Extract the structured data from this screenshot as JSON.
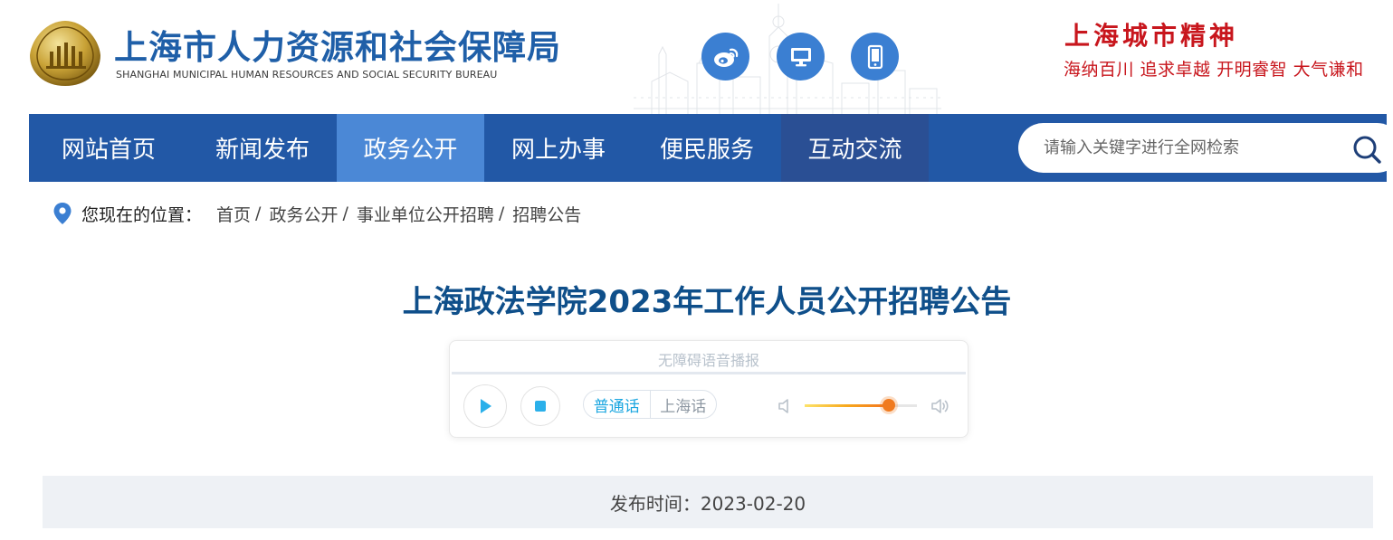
{
  "header": {
    "org_name_cn": "上海市人力资源和社会保障局",
    "org_name_en": "SHANGHAI MUNICIPAL HUMAN RESOURCES AND SOCIAL SECURITY BUREAU",
    "social_icons": [
      "weibo-icon",
      "monitor-icon",
      "mobile-icon"
    ],
    "spirit_title": "上海城市精神",
    "spirit_words": "海纳百川  追求卓越  开明睿智  大气谦和"
  },
  "nav": {
    "items": [
      {
        "label": "网站首页"
      },
      {
        "label": "新闻发布"
      },
      {
        "label": "政务公开"
      },
      {
        "label": "网上办事"
      },
      {
        "label": "便民服务"
      },
      {
        "label": "互动交流"
      }
    ],
    "active_index": 2
  },
  "search": {
    "placeholder": "请输入关键字进行全网检索",
    "value": ""
  },
  "breadcrumb": {
    "label": "您现在的位置：",
    "items": [
      "首页",
      "政务公开",
      "事业单位公开招聘",
      "招聘公告"
    ],
    "separator": "/"
  },
  "article": {
    "title": "上海政法学院2023年工作人员公开招聘公告",
    "publish_info": "发布时间：2023-02-20"
  },
  "audio_player": {
    "label": "无障碍语音播报",
    "progress": 0.0,
    "languages": [
      "普通话",
      "上海话"
    ],
    "selected_language": "普通话",
    "volume": 0.75
  },
  "colors": {
    "nav_bg": "#2258a6",
    "nav_active": "#4b88d6",
    "title": "#0f4f8a",
    "brand_blue": "#1f5fa8",
    "spirit_red": "#c8161d",
    "accent": "#1aa6e0"
  }
}
